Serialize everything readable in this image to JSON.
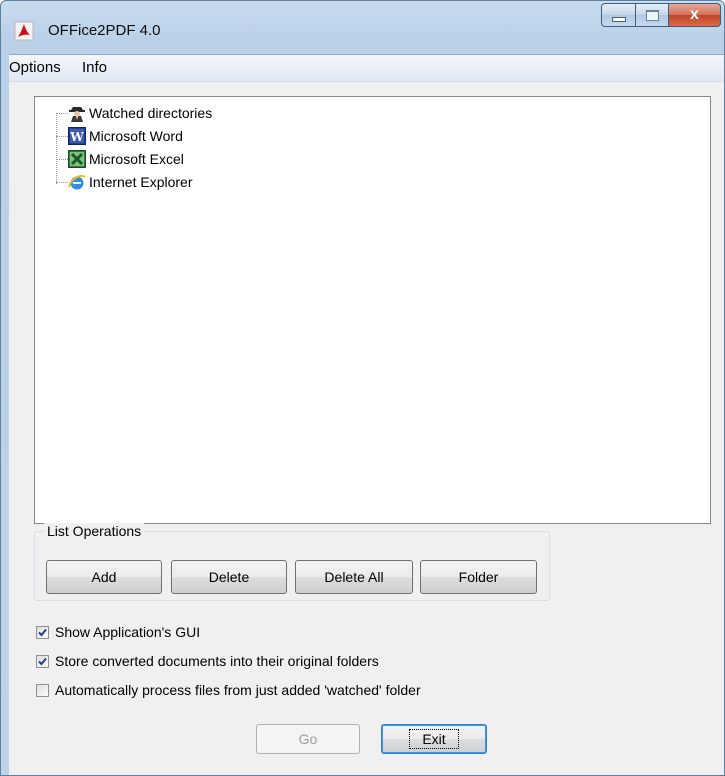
{
  "window": {
    "title": "OFFice2PDF 4.0",
    "app_icon": "pdf-app-icon",
    "caption_buttons": [
      "minimize",
      "maximize",
      "close"
    ],
    "close_glyph": "x"
  },
  "menu": {
    "items": [
      {
        "label": "Options"
      },
      {
        "label": "Info"
      }
    ]
  },
  "tree": {
    "items": [
      {
        "label": "Watched directories",
        "icon": "spy-icon"
      },
      {
        "label": "Microsoft Word",
        "icon": "word-icon"
      },
      {
        "label": "Microsoft Excel",
        "icon": "excel-icon"
      },
      {
        "label": "Internet Explorer",
        "icon": "ie-icon"
      }
    ]
  },
  "list_operations": {
    "group_label": "List Operations",
    "buttons": [
      {
        "label": "Add"
      },
      {
        "label": "Delete"
      },
      {
        "label": "Delete All"
      },
      {
        "label": "Folder"
      }
    ]
  },
  "options": {
    "checkboxes": [
      {
        "label": "Show Application's GUI",
        "checked": true
      },
      {
        "label": "Store converted documents into their original folders",
        "checked": true
      },
      {
        "label": "Automatically process files from just added 'watched' folder",
        "checked": false
      }
    ]
  },
  "actions": {
    "go_label": "Go",
    "go_enabled": false,
    "exit_label": "Exit"
  },
  "colors": {
    "window_frame": "#bcd3ea",
    "close_button": "#c0452a",
    "client_bg": "#f0f0f0",
    "check_mark": "#1e3f8a"
  }
}
